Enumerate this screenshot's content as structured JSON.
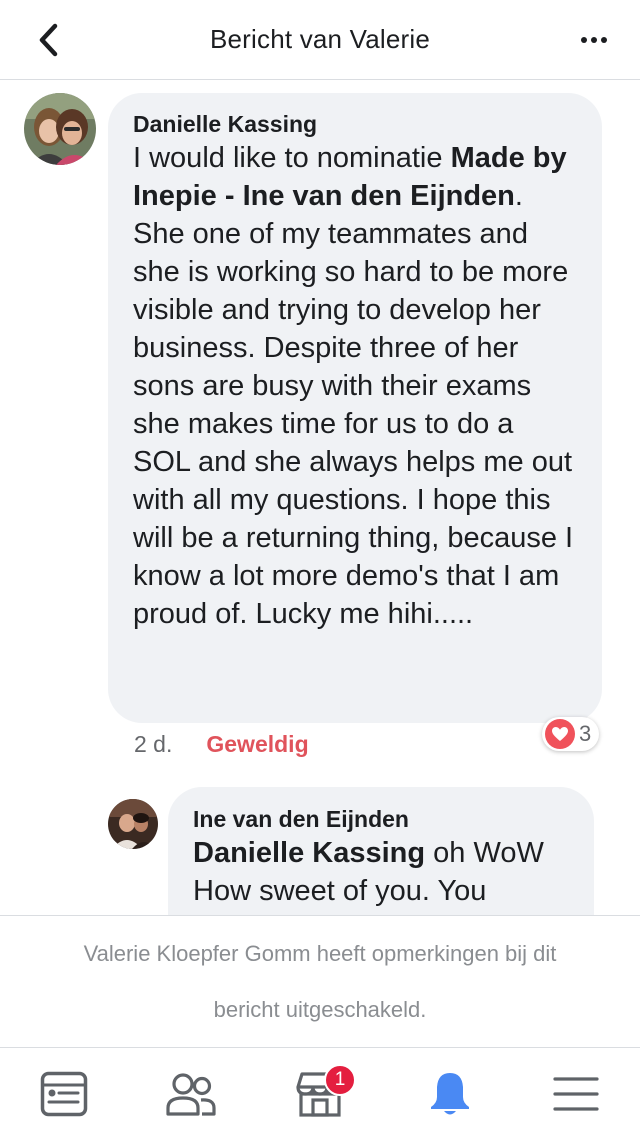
{
  "header": {
    "title": "Bericht van Valerie"
  },
  "comment": {
    "author": "Danielle Kassing",
    "text_before": "I would like to nominatie ",
    "mention": "Made by Inepie - Ine van den Eijnden",
    "text_after": ". She one of my teammates and she is working so hard to be more visible and trying to develop her business. Despite three of her sons are busy with their exams she makes time for us to do a SOL and she always helps me out with all my questions. I hope this will be a returning thing, because I know a lot more demo's that I am proud of. Lucky me hihi.....",
    "time": "2 d.",
    "reaction_label": "Geweldig",
    "reaction_count": "3"
  },
  "reply": {
    "author": "Ine van den Eijnden",
    "mention": "Danielle Kassing",
    "text": " oh WoW How sweet of you. You"
  },
  "disabled_note": {
    "line1": "Valerie Kloepfer Gomm heeft opmerkingen bij dit",
    "line2": "bericht uitgeschakeld."
  },
  "tabbar": {
    "notification_badge": "1"
  },
  "colors": {
    "accent_blue": "#4a89f3",
    "reaction_red": "#e0535b",
    "bubble_bg": "#f0f2f5"
  },
  "icons": {
    "back": "chevron-left-icon",
    "more": "more-dots-icon",
    "feed": "news-feed-icon",
    "friends": "friends-icon",
    "marketplace": "marketplace-icon",
    "notifications": "bell-icon",
    "menu": "menu-icon"
  }
}
